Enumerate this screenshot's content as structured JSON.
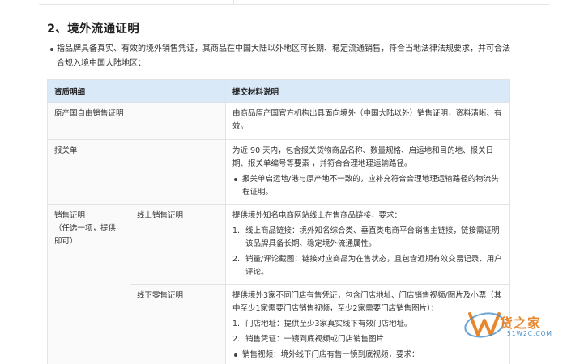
{
  "section": {
    "heading": "2、境外流通证明",
    "intro": "指品牌具备真实、有效的境外销售凭证，其商品在中国大陆以外地区可长期、稳定流通销售，符合当地法律法规要求，并可合法合规入境中国大陆地区："
  },
  "table": {
    "headers": [
      "资质明细",
      "提交材料说明"
    ],
    "rows": {
      "origin": {
        "label": "原产国自由销售证明",
        "desc": "由商品原产国官方机构出具面向境外（中国大陆以外）销售证明，资料清晰、有效。"
      },
      "customs": {
        "label": "报关单",
        "desc": "为近 90 天内，包含报关货物商品名称、数量规格、启运地和目的地、报关日期、报关单编号等要素 ，并符合合理地理运输路径。",
        "bullet": "报关单启运地/港与原产地不一致的，应补充符合合理地理运输路径的物流头程证明。"
      },
      "sales": {
        "label": "销售证明",
        "note": "（任选一项，提供即可）",
        "online": {
          "label": "线上销售证明",
          "desc": "提供境外知名电商网站线上在售商品链接，要求：",
          "items": [
            {
              "num": "1.",
              "text": "线上商品链接：境外知名综合类、垂直类电商平台销售主链接，链接需证明该品牌具备长期、稳定境外流通属性。"
            },
            {
              "num": "2.",
              "text": "销量/评论截图：链接对应商品为在售状态，且包含近期有效交易记录、用户评论。"
            }
          ]
        },
        "offline": {
          "label": "线下零售证明",
          "desc": "提供境外3家不同门店有售凭证，包含门店地址、门店销售视频/图片及小票（其中至少1家需要门店销售视频，至少2家需要门店销售图片）：",
          "items": [
            {
              "num": "1.",
              "text": "门店地址：提供至少3家真实线下有效门店地址。"
            },
            {
              "num": "2.",
              "text": "销售凭证：一镜到底视频或门店销售图片"
            }
          ],
          "bullet": "销售视频：境外线下门店有售一镜到底视频，要求："
        }
      }
    }
  },
  "watermark": {
    "brand": "货之家",
    "site": "51W2C.COM",
    "colors": {
      "orange": "#e8862e",
      "blue": "#4a90c8"
    }
  }
}
